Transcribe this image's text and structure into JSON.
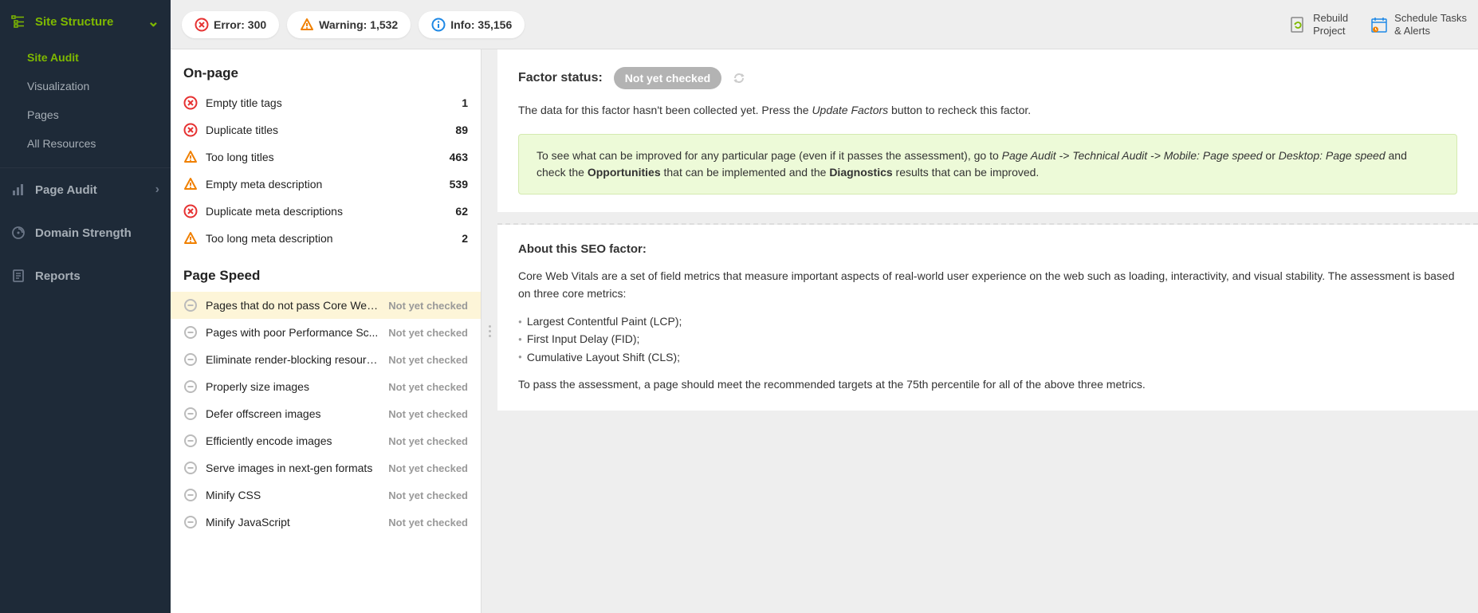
{
  "sidebar": {
    "siteStructure": {
      "label": "Site Structure"
    },
    "sub": {
      "siteAudit": "Site Audit",
      "visualization": "Visualization",
      "pages": "Pages",
      "allResources": "All Resources"
    },
    "pageAudit": "Page Audit",
    "domainStrength": "Domain Strength",
    "reports": "Reports"
  },
  "topbar": {
    "errorLabel": "Error: 300",
    "warningLabel": "Warning: 1,532",
    "infoLabel": "Info: 35,156",
    "rebuildLine1": "Rebuild",
    "rebuildLine2": "Project",
    "scheduleLine1": "Schedule Tasks",
    "scheduleLine2": "& Alerts"
  },
  "factors": {
    "onPage": {
      "title": "On-page",
      "items": [
        {
          "name": "Empty title tags",
          "value": "1",
          "type": "error"
        },
        {
          "name": "Duplicate titles",
          "value": "89",
          "type": "error"
        },
        {
          "name": "Too long titles",
          "value": "463",
          "type": "warning"
        },
        {
          "name": "Empty meta description",
          "value": "539",
          "type": "warning"
        },
        {
          "name": "Duplicate meta descriptions",
          "value": "62",
          "type": "error"
        },
        {
          "name": "Too long meta description",
          "value": "2",
          "type": "warning"
        }
      ]
    },
    "pageSpeed": {
      "title": "Page Speed",
      "items": [
        {
          "name": "Pages that do not pass Core Web...",
          "status": "Not yet checked",
          "selected": true
        },
        {
          "name": "Pages with poor Performance Sc...",
          "status": "Not yet checked"
        },
        {
          "name": "Eliminate render-blocking resourc...",
          "status": "Not yet checked"
        },
        {
          "name": "Properly size images",
          "status": "Not yet checked"
        },
        {
          "name": "Defer offscreen images",
          "status": "Not yet checked"
        },
        {
          "name": "Efficiently encode images",
          "status": "Not yet checked"
        },
        {
          "name": "Serve images in next-gen formats",
          "status": "Not yet checked"
        },
        {
          "name": "Minify CSS",
          "status": "Not yet checked"
        },
        {
          "name": "Minify JavaScript",
          "status": "Not yet checked"
        }
      ]
    }
  },
  "detail": {
    "factorStatusLabel": "Factor status:",
    "factorStatusBadge": "Not yet checked",
    "descPre": "The data for this factor hasn't been collected yet. Press the ",
    "descEm": "Update Factors",
    "descPost": " button to recheck this factor.",
    "tipPart1": "To see what can be improved for any particular page (even if it passes the assessment), go to ",
    "tipEm1": "Page Audit -> Technical Audit -> Mobile: Page speed",
    "tipPart2": " or ",
    "tipEm2": "Desktop: Page speed",
    "tipPart3": " and check the ",
    "tipBold1": "Opportunities",
    "tipPart4": " that can be implemented and the ",
    "tipBold2": "Diagnostics",
    "tipPart5": " results that can be improved.",
    "aboutTitle": "About this SEO factor:",
    "aboutP1": "Core Web Vitals are a set of field metrics that measure important aspects of real-world user experience on the web such as loading, interactivity, and visual stability. The assessment is based on three core metrics:",
    "aboutLi1": "Largest Contentful Paint (LCP);",
    "aboutLi2": "First Input Delay (FID);",
    "aboutLi3": "Cumulative Layout Shift (CLS);",
    "aboutP2": "To pass the assessment, a page should meet the recommended targets at the 75th percentile for all of the above three metrics."
  }
}
